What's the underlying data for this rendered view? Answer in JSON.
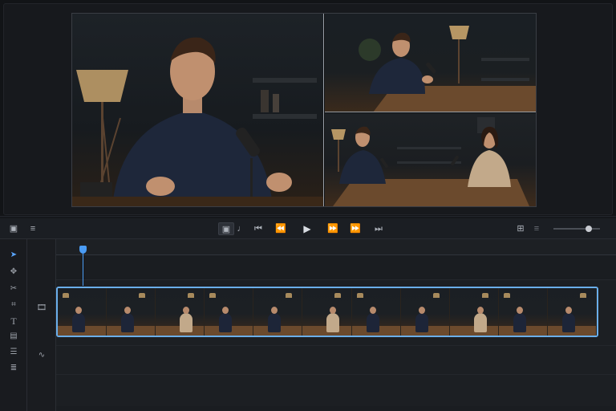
{
  "viewer": {
    "panes": [
      {
        "name": "main-camera",
        "description": "close-up host"
      },
      {
        "name": "wide-host",
        "description": "host at desk"
      },
      {
        "name": "two-shot",
        "description": "host and guest"
      }
    ]
  },
  "transport": {
    "icons": [
      "monitor-icon",
      "menu-icon",
      "safe-frame-icon",
      "audio-note-icon",
      "skip-to-start-icon",
      "rewind-icon",
      "play-icon",
      "fast-forward-icon",
      "step-forward-icon",
      "skip-to-end-icon",
      "grid-icon",
      "list-icon"
    ],
    "zoom_level": 0.75
  },
  "tools": [
    "select-tool-icon",
    "move-tool-icon",
    "razor-tool-icon",
    "crop-tool-icon",
    "text-tool-icon",
    "caption-tool-icon",
    "subtitle-tool-icon",
    "layers-tool-icon"
  ],
  "tracks": [
    {
      "type": "video",
      "icon": "film-icon"
    },
    {
      "type": "audio",
      "icon": "waveform-icon"
    }
  ],
  "timeline": {
    "clip": {
      "thumbnail_count": 11
    },
    "playhead_fraction": 0.05
  },
  "colors": {
    "accent": "#4a9cf5",
    "clip_border": "#6aaeea"
  }
}
